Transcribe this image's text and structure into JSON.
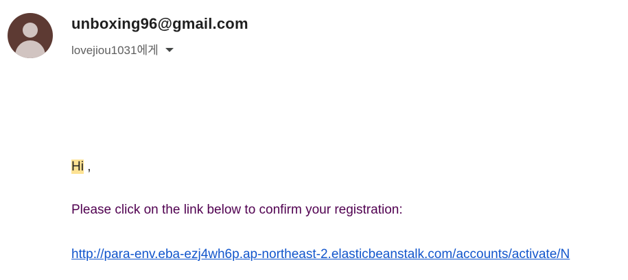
{
  "email": {
    "sender": "unboxing96@gmail.com",
    "recipient": "lovejiou1031에게",
    "recipient_menu_icon": "caret-down-icon",
    "avatar_icon": "default-person-avatar",
    "avatar_color": "#5d3a33"
  },
  "body": {
    "greeting_word": "Hi",
    "greeting_punct": " ,",
    "highlight_color": "#fde293",
    "message": "Please click on the link below to confirm your registration:",
    "message_color": "#500050",
    "link": "http://para-env.eba-ezj4wh6p.ap-northeast-2.elasticbeanstalk.com/accounts/activate/N",
    "link_color": "#1155cc"
  }
}
